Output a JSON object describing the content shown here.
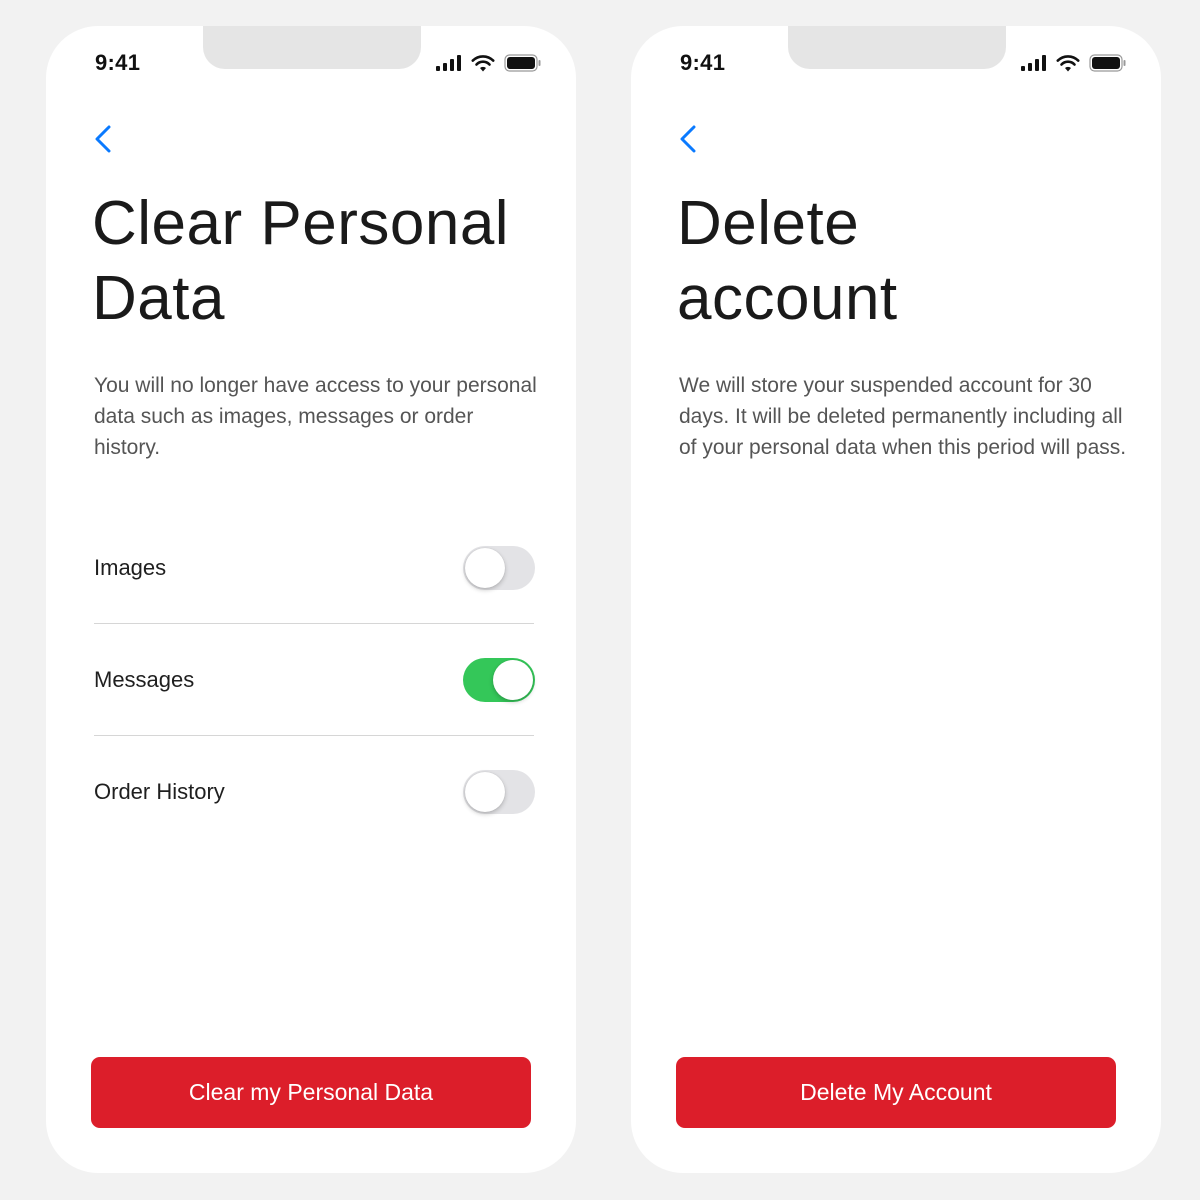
{
  "colors": {
    "accent_blue": "#0a7aff",
    "danger_red": "#dc1e2a",
    "toggle_on": "#34c759",
    "toggle_off": "#e3e3e6",
    "background": "#f2f2f2"
  },
  "screens": [
    {
      "status_bar": {
        "time": "9:41",
        "icons": [
          "cellular-signal-icon",
          "wifi-icon",
          "battery-icon"
        ]
      },
      "back_icon": "chevron-left-icon",
      "title": "Clear Personal Data",
      "description": "You will no longer have access to your personal data such as images, messages or order history.",
      "options": [
        {
          "label": "Images",
          "enabled": false
        },
        {
          "label": "Messages",
          "enabled": true
        },
        {
          "label": "Order History",
          "enabled": false
        }
      ],
      "button_label": "Clear my Personal Data"
    },
    {
      "status_bar": {
        "time": "9:41",
        "icons": [
          "cellular-signal-icon",
          "wifi-icon",
          "battery-icon"
        ]
      },
      "back_icon": "chevron-left-icon",
      "title": "Delete account",
      "description": "We will store your suspended account for 30 days. It will be deleted permanently including all of your personal data when this period will pass.",
      "button_label": "Delete My Account"
    }
  ]
}
